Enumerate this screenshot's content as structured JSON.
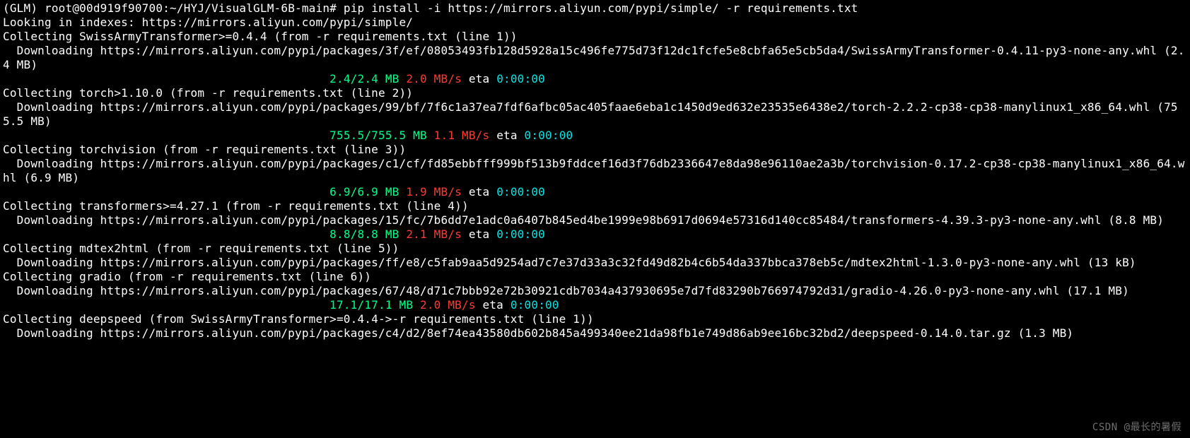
{
  "prompt": {
    "env": "(GLM)",
    "user_host": "root@00d919f90700",
    "cwd": "~/HYJ/VisualGLM-6B-main",
    "sep": "#",
    "command": "pip install -i https://mirrors.aliyun.com/pypi/simple/ -r requirements.txt"
  },
  "index_line": "Looking in indexes: https://mirrors.aliyun.com/pypi/simple/",
  "packages": [
    {
      "collect": "Collecting SwissArmyTransformer>=0.4.4 (from -r requirements.txt (line 1))",
      "download": "  Downloading https://mirrors.aliyun.com/pypi/packages/3f/ef/08053493fb128d5928a15c496fe775d73f12dc1fcfe5e8cbfa65e5cb5da4/SwissArmyTransformer-0.4.11-py3-none-any.whl (2.4 MB)",
      "progress": {
        "done": "2.4/2.4 MB",
        "speed": "2.0 MB/s",
        "eta_label": "eta",
        "eta": "0:00:00"
      }
    },
    {
      "collect": "Collecting torch>1.10.0 (from -r requirements.txt (line 2))",
      "download": "  Downloading https://mirrors.aliyun.com/pypi/packages/99/bf/7f6c1a37ea7fdf6afbc05ac405faae6eba1c1450d9ed632e23535e6438e2/torch-2.2.2-cp38-cp38-manylinux1_x86_64.whl (755.5 MB)",
      "progress": {
        "done": "755.5/755.5 MB",
        "speed": "1.1 MB/s",
        "eta_label": "eta",
        "eta": "0:00:00"
      }
    },
    {
      "collect": "Collecting torchvision (from -r requirements.txt (line 3))",
      "download": "  Downloading https://mirrors.aliyun.com/pypi/packages/c1/cf/fd85ebbfff999bf513b9fddcef16d3f76db2336647e8da98e96110ae2a3b/torchvision-0.17.2-cp38-cp38-manylinux1_x86_64.whl (6.9 MB)",
      "progress": {
        "done": "6.9/6.9 MB",
        "speed": "1.9 MB/s",
        "eta_label": "eta",
        "eta": "0:00:00"
      }
    },
    {
      "collect": "Collecting transformers>=4.27.1 (from -r requirements.txt (line 4))",
      "download": "  Downloading https://mirrors.aliyun.com/pypi/packages/15/fc/7b6dd7e1adc0a6407b845ed4be1999e98b6917d0694e57316d140cc85484/transformers-4.39.3-py3-none-any.whl (8.8 MB)",
      "progress": {
        "done": "8.8/8.8 MB",
        "speed": "2.1 MB/s",
        "eta_label": "eta",
        "eta": "0:00:00"
      }
    },
    {
      "collect": "Collecting mdtex2html (from -r requirements.txt (line 5))",
      "download": "  Downloading https://mirrors.aliyun.com/pypi/packages/ff/e8/c5fab9aa5d9254ad7c7e37d33a3c32fd49d82b4c6b54da337bbca378eb5c/mdtex2html-1.3.0-py3-none-any.whl (13 kB)"
    },
    {
      "collect": "Collecting gradio (from -r requirements.txt (line 6))",
      "download": "  Downloading https://mirrors.aliyun.com/pypi/packages/67/48/d71c7bbb92e72b30921cdb7034a437930695e7d7fd83290b766974792d31/gradio-4.26.0-py3-none-any.whl (17.1 MB)",
      "progress": {
        "done": "17.1/17.1 MB",
        "speed": "2.0 MB/s",
        "eta_label": "eta",
        "eta": "0:00:00"
      }
    },
    {
      "collect": "Collecting deepspeed (from SwissArmyTransformer>=0.4.4->-r requirements.txt (line 1))",
      "download": "  Downloading https://mirrors.aliyun.com/pypi/packages/c4/d2/8ef74ea43580db602b845a499340ee21da98fb1e749d86ab9ee16bc32bd2/deepspeed-0.14.0.tar.gz (1.3 MB)"
    }
  ],
  "progress_indent": "                                              ",
  "watermark": "CSDN @最长的暑假"
}
